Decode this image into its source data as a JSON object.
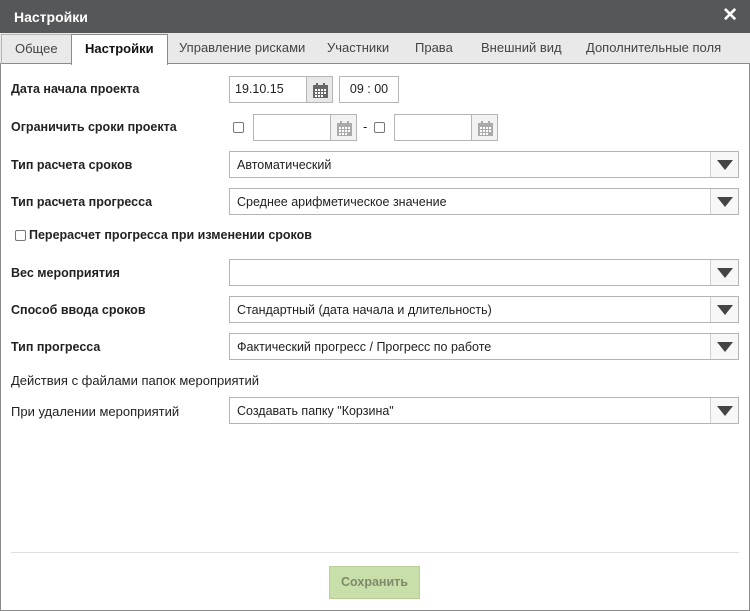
{
  "window": {
    "title": "Настройки",
    "close_icon": "close-icon"
  },
  "tabs": [
    {
      "label": "Общее"
    },
    {
      "label": "Настройки",
      "active": true
    },
    {
      "label": "Управление рисками"
    },
    {
      "label": "Участники"
    },
    {
      "label": "Права"
    },
    {
      "label": "Внешний вид"
    },
    {
      "label": "Дополнительные поля"
    }
  ],
  "form": {
    "start_date": {
      "label": "Дата начала проекта",
      "date": "19.10.15",
      "time": "09 : 00"
    },
    "limit_dates": {
      "label": "Ограничить сроки проекта",
      "separator": "-",
      "from": "",
      "to": ""
    },
    "term_calc": {
      "label": "Тип расчета сроков",
      "value": "Автоматический"
    },
    "progress_calc": {
      "label": "Тип расчета прогресса",
      "value": "Среднее арифметическое значение"
    },
    "recalc_checkbox": {
      "label": "Перерасчет прогресса при изменении сроков",
      "checked": false
    },
    "weight": {
      "label": "Вес мероприятия",
      "value": ""
    },
    "term_input": {
      "label": "Способ ввода сроков",
      "value": "Стандартный (дата начала и длительность)"
    },
    "progress_type": {
      "label": "Тип прогресса",
      "value": "Фактический прогресс / Прогресс по работе"
    },
    "files_section": {
      "label": "Действия с файлами папок мероприятий"
    },
    "on_delete": {
      "label": "При удалении мероприятий",
      "value": "Создавать папку \"Корзина\""
    }
  },
  "footer": {
    "save_label": "Сохранить"
  },
  "colors": {
    "titlebar": "#555759",
    "save_button": "#c9dfa9",
    "border": "#b5b5b5"
  }
}
